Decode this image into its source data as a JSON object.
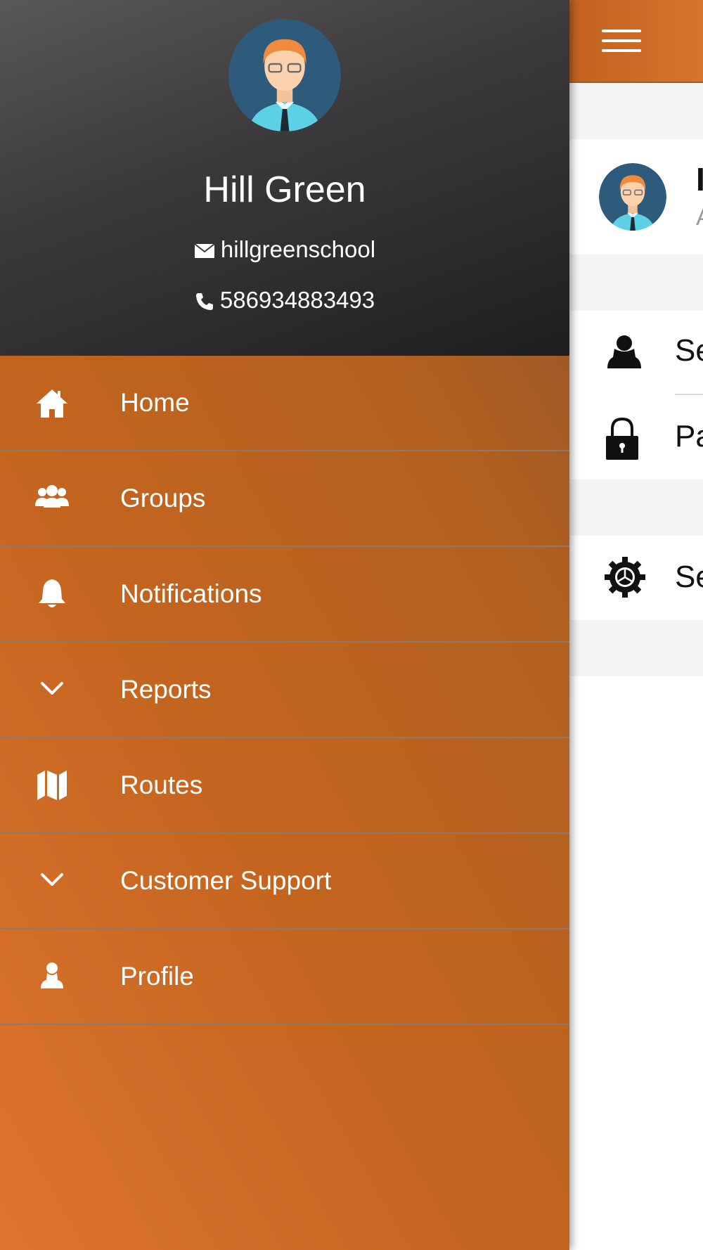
{
  "drawer": {
    "user": {
      "name": "Hill Green",
      "email": "hillgreenschool",
      "phone": "586934883493"
    },
    "items": [
      {
        "label": "Home",
        "icon": "home-icon"
      },
      {
        "label": "Groups",
        "icon": "groups-icon"
      },
      {
        "label": "Notifications",
        "icon": "bell-icon"
      },
      {
        "label": "Reports",
        "icon": "chevron-down-icon"
      },
      {
        "label": "Routes",
        "icon": "map-icon"
      },
      {
        "label": "Customer Support",
        "icon": "chevron-down-icon"
      },
      {
        "label": "Profile",
        "icon": "person-icon"
      }
    ]
  },
  "main": {
    "profile": {
      "name": "I",
      "subtitle": "A"
    },
    "rows": [
      {
        "label": "Se",
        "icon": "person-icon"
      },
      {
        "label": "Pa",
        "icon": "lock-icon"
      },
      {
        "label": "Se",
        "icon": "gear-icon"
      }
    ]
  },
  "colors": {
    "accent": "#c4651f",
    "header_dark": "#1e1e20",
    "section_gray": "#f3f3f3"
  }
}
